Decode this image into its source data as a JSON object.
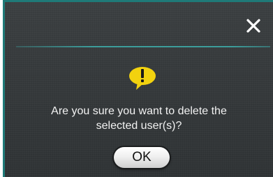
{
  "dialog": {
    "close_icon": "close-icon",
    "warning_icon": "exclamation-speech-bubble-icon",
    "message_line1": "Are you sure you want to delete the",
    "message_line2": "selected user(s)?",
    "ok_label": "OK",
    "colors": {
      "background": "#34383a",
      "accent": "#3d9e9c",
      "warning": "#f2d20f",
      "text": "#f2f2f2"
    }
  }
}
